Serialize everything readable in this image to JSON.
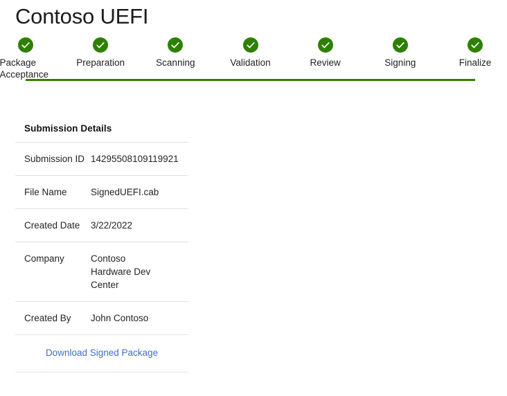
{
  "page": {
    "title": "Contoso UEFI"
  },
  "colors": {
    "step_complete": "#2d8000",
    "link": "#3f6fc4",
    "divider": "#e1e1e1",
    "text": "#242424"
  },
  "stepper": {
    "steps": [
      {
        "label": "Package Acceptance",
        "state": "complete",
        "icon": "check-icon"
      },
      {
        "label": "Preparation",
        "state": "complete",
        "icon": "check-icon"
      },
      {
        "label": "Scanning",
        "state": "complete",
        "icon": "check-icon"
      },
      {
        "label": "Validation",
        "state": "complete",
        "icon": "check-icon"
      },
      {
        "label": "Review",
        "state": "complete",
        "icon": "check-icon"
      },
      {
        "label": "Signing",
        "state": "complete",
        "icon": "check-icon"
      },
      {
        "label": "Finalize",
        "state": "complete",
        "icon": "check-icon"
      }
    ]
  },
  "details": {
    "title": "Submission Details",
    "rows": [
      {
        "label": "Submission ID",
        "value": "14295508109119921"
      },
      {
        "label": "File Name",
        "value": "SignedUEFI.cab"
      },
      {
        "label": "Created Date",
        "value": "3/22/2022"
      },
      {
        "label": "Company",
        "value": "Contoso Hardware Dev Center",
        "value_lines": [
          "Contoso",
          "Hardware Dev",
          "Center"
        ]
      },
      {
        "label": "Created By",
        "value": "John Contoso"
      }
    ],
    "download_label": "Download Signed Package"
  }
}
